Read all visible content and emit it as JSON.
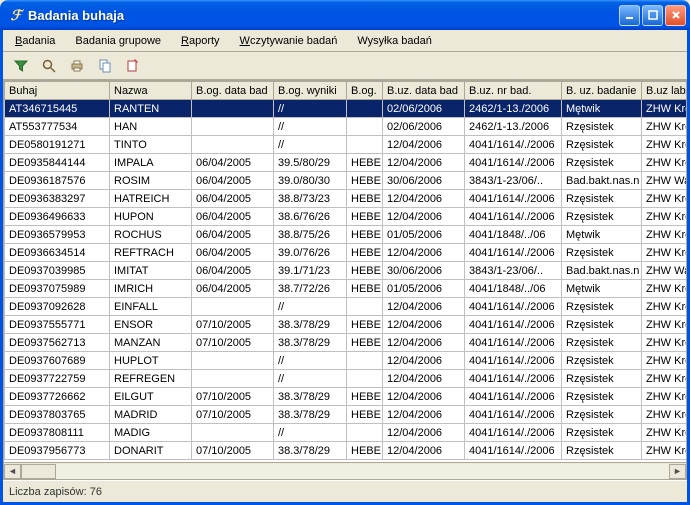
{
  "title": "Badania buhaja",
  "menu": [
    "Badania",
    "Badania grupowe",
    "Raporty",
    "Wczytywanie badań",
    "Wysyłka badań"
  ],
  "menu_accel": [
    "B",
    "",
    "R",
    "W",
    ""
  ],
  "toolbar_icons": [
    "filter-icon",
    "search-icon",
    "print-icon",
    "copy-icon",
    "new-icon"
  ],
  "columns": [
    "Buhaj",
    "Nazwa",
    "B.og. data bad",
    "B.og. wyniki",
    "B.og.",
    "B.uz. data bad",
    "B.uz. nr bad.",
    "B. uz. badanie",
    "B.uz lab/prac"
  ],
  "rows": [
    [
      "AT346715445",
      "RANTEN",
      "",
      "//",
      "",
      "02/06/2006",
      "2462/1-13./2006",
      "Mętwik",
      "ZHW Krosno"
    ],
    [
      "AT553777534",
      "HAN",
      "",
      "//",
      "",
      "02/06/2006",
      "2462/1-13./2006",
      "Rzęsistek",
      "ZHW Krosno"
    ],
    [
      "DE0580191271",
      "TINTO",
      "",
      "//",
      "",
      "12/04/2006",
      "4041/1614/./2006",
      "Rzęsistek",
      "ZHW Krosno"
    ],
    [
      "DE0935844144",
      "IMPALA",
      "06/04/2005",
      "39.5/80/29",
      "HEBE",
      "12/04/2006",
      "4041/1614/./2006",
      "Rzęsistek",
      "ZHW Krosno"
    ],
    [
      "DE0936187576",
      "ROSIM",
      "06/04/2005",
      "39.0/80/30",
      "HEBE",
      "30/06/2006",
      "3843/1-23/06/..",
      "Bad.bakt.nas.n",
      "ZHW Warszawa"
    ],
    [
      "DE0936383297",
      "HATREICH",
      "06/04/2005",
      "38.8/73/23",
      "HEBE",
      "12/04/2006",
      "4041/1614/./2006",
      "Rzęsistek",
      "ZHW Krosno"
    ],
    [
      "DE0936496633",
      "HUPON",
      "06/04/2005",
      "38.6/76/26",
      "HEBE",
      "12/04/2006",
      "4041/1614/./2006",
      "Rzęsistek",
      "ZHW Krosno"
    ],
    [
      "DE0936579953",
      "ROCHUS",
      "06/04/2005",
      "38.8/75/26",
      "HEBE",
      "01/05/2006",
      "4041/1848/../06",
      "Mętwik",
      "ZHW Krosno"
    ],
    [
      "DE0936634514",
      "REFTRACH",
      "06/04/2005",
      "39.0/76/26",
      "HEBE",
      "12/04/2006",
      "4041/1614/./2006",
      "Rzęsistek",
      "ZHW Krosno"
    ],
    [
      "DE0937039985",
      "IMITAT",
      "06/04/2005",
      "39.1/71/23",
      "HEBE",
      "30/06/2006",
      "3843/1-23/06/..",
      "Bad.bakt.nas.n",
      "ZHW Warszawa"
    ],
    [
      "DE0937075989",
      "IMRICH",
      "06/04/2005",
      "38.7/72/26",
      "HEBE",
      "01/05/2006",
      "4041/1848/../06",
      "Mętwik",
      "ZHW Krosno"
    ],
    [
      "DE0937092628",
      "EINFALL",
      "",
      "//",
      "",
      "12/04/2006",
      "4041/1614/./2006",
      "Rzęsistek",
      "ZHW Krosno"
    ],
    [
      "DE0937555771",
      "ENSOR",
      "07/10/2005",
      "38.3/78/29",
      "HEBE",
      "12/04/2006",
      "4041/1614/./2006",
      "Rzęsistek",
      "ZHW Krosno"
    ],
    [
      "DE0937562713",
      "MANZAN",
      "07/10/2005",
      "38.3/78/29",
      "HEBE",
      "12/04/2006",
      "4041/1614/./2006",
      "Rzęsistek",
      "ZHW Krosno"
    ],
    [
      "DE0937607689",
      "HUPLOT",
      "",
      "//",
      "",
      "12/04/2006",
      "4041/1614/./2006",
      "Rzęsistek",
      "ZHW Krosno"
    ],
    [
      "DE0937722759",
      "REFREGEN",
      "",
      "//",
      "",
      "12/04/2006",
      "4041/1614/./2006",
      "Rzęsistek",
      "ZHW Krosno"
    ],
    [
      "DE0937726662",
      "EILGUT",
      "07/10/2005",
      "38.3/78/29",
      "HEBE",
      "12/04/2006",
      "4041/1614/./2006",
      "Rzęsistek",
      "ZHW Krosno"
    ],
    [
      "DE0937803765",
      "MADRID",
      "07/10/2005",
      "38.3/78/29",
      "HEBE",
      "12/04/2006",
      "4041/1614/./2006",
      "Rzęsistek",
      "ZHW Krosno"
    ],
    [
      "DE0937808111",
      "MADIG",
      "",
      "//",
      "",
      "12/04/2006",
      "4041/1614/./2006",
      "Rzęsistek",
      "ZHW Krosno"
    ],
    [
      "DE0937956773",
      "DONARIT",
      "07/10/2005",
      "38.3/78/29",
      "HEBE",
      "12/04/2006",
      "4041/1614/./2006",
      "Rzęsistek",
      "ZHW Krosno"
    ]
  ],
  "selected_row": 0,
  "status": "Liczba zapisów: 76"
}
